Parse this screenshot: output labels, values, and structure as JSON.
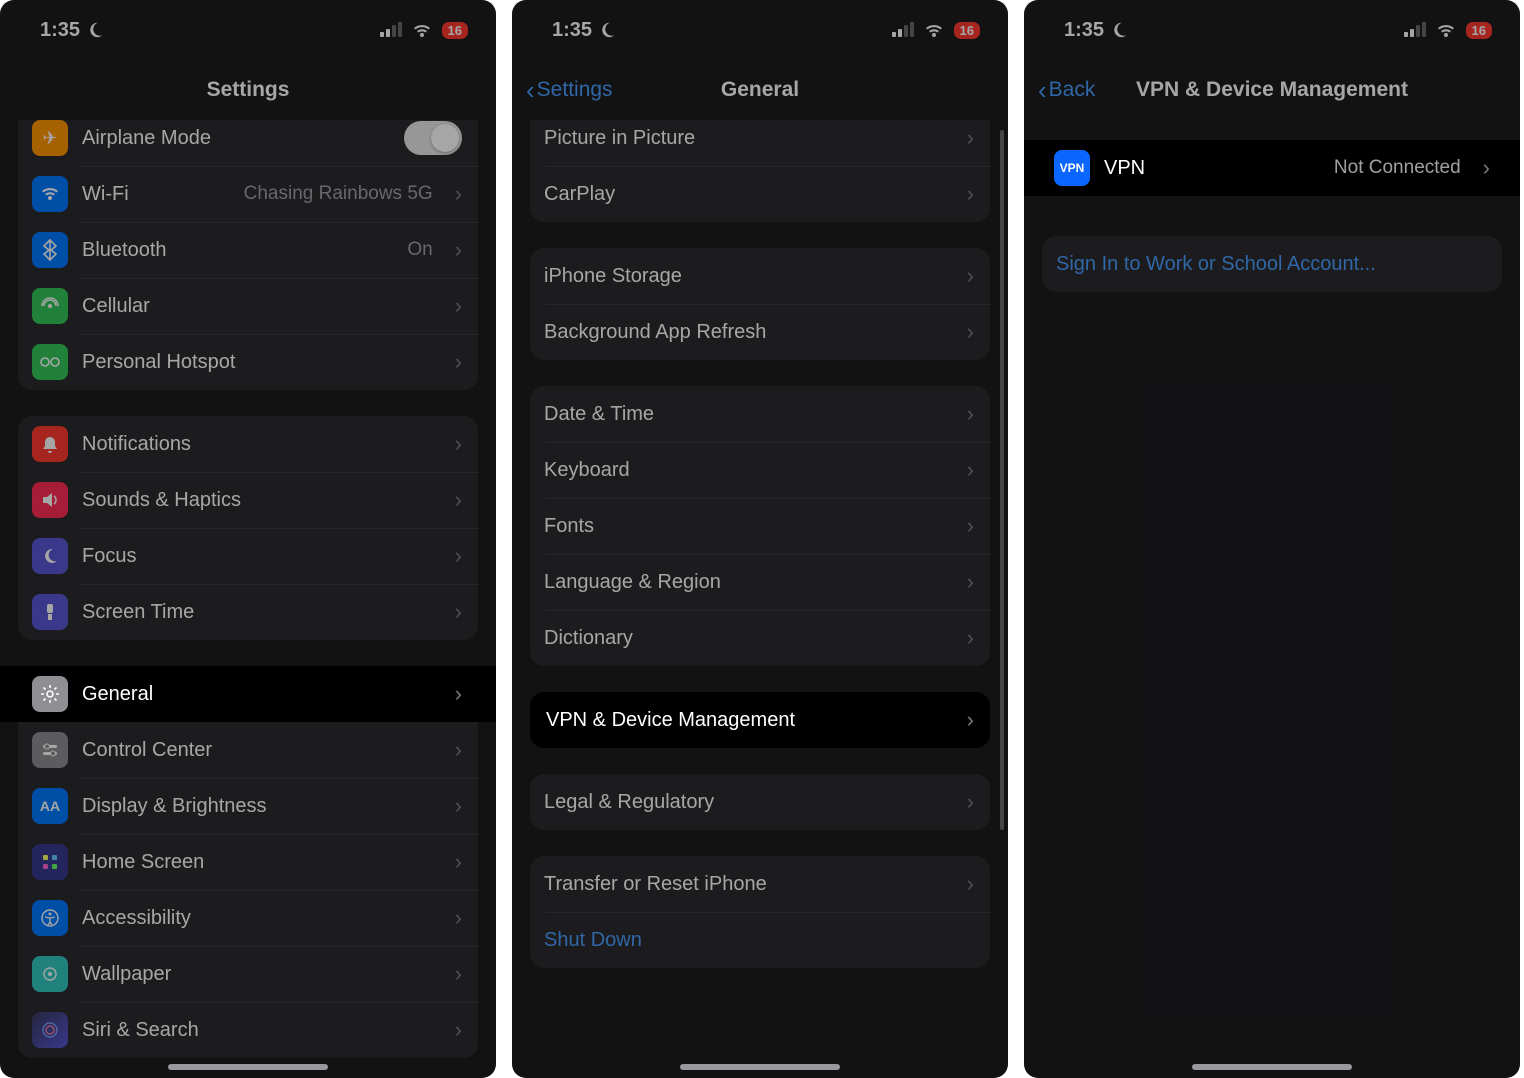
{
  "status": {
    "time": "1:35",
    "battery": "16"
  },
  "panel1": {
    "title": "Settings",
    "airplane": "Airplane Mode",
    "wifi": {
      "label": "Wi-Fi",
      "value": "Chasing Rainbows 5G"
    },
    "bluetooth": {
      "label": "Bluetooth",
      "value": "On"
    },
    "cellular": "Cellular",
    "hotspot": "Personal Hotspot",
    "notifications": "Notifications",
    "sounds": "Sounds & Haptics",
    "focus": "Focus",
    "screentime": "Screen Time",
    "general": "General",
    "controlcenter": "Control Center",
    "display": "Display & Brightness",
    "homescreen": "Home Screen",
    "accessibility": "Accessibility",
    "wallpaper": "Wallpaper",
    "siri": "Siri & Search"
  },
  "panel2": {
    "back": "Settings",
    "title": "General",
    "rows": {
      "pip": "Picture in Picture",
      "carplay": "CarPlay",
      "storage": "iPhone Storage",
      "refresh": "Background App Refresh",
      "datetime": "Date & Time",
      "keyboard": "Keyboard",
      "fonts": "Fonts",
      "language": "Language & Region",
      "dictionary": "Dictionary",
      "vpn": "VPN & Device Management",
      "legal": "Legal & Regulatory",
      "transfer": "Transfer or Reset iPhone",
      "shutdown": "Shut Down"
    }
  },
  "panel3": {
    "back": "Back",
    "title": "VPN & Device Management",
    "vpn": {
      "label": "VPN",
      "value": "Not Connected",
      "icon": "VPN"
    },
    "signin": "Sign In to Work or School Account..."
  },
  "colors": {
    "accent": "#4a9eff",
    "rowbg": "#2c2c2e",
    "highlight": "#000000"
  }
}
